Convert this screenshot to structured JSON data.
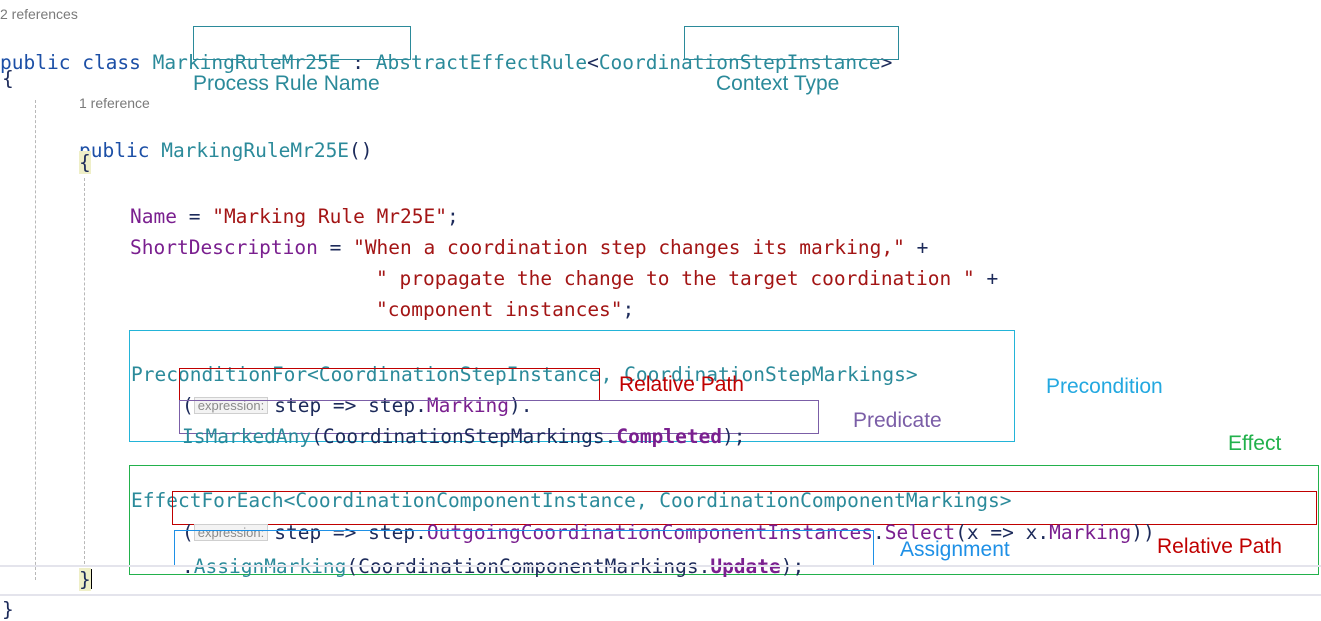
{
  "class_refs": "2 references",
  "ctor_refs": "1 reference",
  "class_line": {
    "kw1": "public",
    "kw2": "class",
    "class_name": "MarkingRuleMr25E",
    "colon": " : ",
    "base": "AbstractEffectRule",
    "lt": "<",
    "ctx_type": "CoordinationStep",
    "ctx_rest": "Instance",
    "gt": ">"
  },
  "open_brace": "{",
  "close_brace": "}",
  "ctor_line": {
    "kw": "public",
    "name": "MarkingRuleMr25E",
    "parens": "()"
  },
  "name_line": {
    "prop": "Name",
    "op": " = ",
    "value": "\"Marking Rule Mr25E\"",
    "end": ";"
  },
  "desc_line1": {
    "prop": "ShortDescription",
    "op": " = ",
    "value": "\"When a coordination step changes its marking,\"",
    "plus": " +"
  },
  "desc_line2": {
    "value": "\" propagate the change to the target coordination \"",
    "plus": " +"
  },
  "desc_line3": {
    "value": "\"component instances\"",
    "end": ";"
  },
  "precondition": {
    "method": "PreconditionFor",
    "type_args": "<CoordinationStepInstance, CoordinationStepMarkings>",
    "hint": "expression:",
    "lambda_open": "(",
    "lambda_a": "step => step.",
    "lambda_member": "Marking",
    "lambda_close": ").",
    "pred_method": "IsMarkedAny",
    "pred_args_a": "(CoordinationStepMarkings.",
    "pred_value": "Completed",
    "pred_end": ");"
  },
  "effect": {
    "method": "EffectForEach",
    "type_args": "<CoordinationComponentInstance, CoordinationComponentMarkings>",
    "hint": "expression:",
    "lambda_open": "(",
    "lambda_a": "step => step.",
    "lambda_member1": "OutgoingCoordinationComponentInstances",
    "lambda_dot": ".",
    "lambda_member2": "Select",
    "lambda_b": "(x => x.",
    "lambda_member3": "Marking",
    "lambda_close": "))",
    "assign_a": ".",
    "assign_method": "AssignMarking",
    "assign_args": "(CoordinationComponentMarkings.",
    "assign_value": "Update",
    "assign_end": ");"
  },
  "annotations": {
    "process_rule_name": "Process Rule Name",
    "context_type": "Context Type",
    "relative_path_1": "Relative Path",
    "precondition": "Precondition",
    "predicate": "Predicate",
    "effect": "Effect",
    "assignment": "Assignment",
    "relative_path_2": "Relative Path"
  },
  "colors": {
    "process_rule_box": "#2b8a9a",
    "context_box": "#2b8a9a",
    "precondition_box": "#23b4d8",
    "relative_path_box": "#c00000",
    "predicate_box": "#7b5ea7",
    "effect_box": "#22b14c",
    "assignment_box": "#1e90e6"
  }
}
